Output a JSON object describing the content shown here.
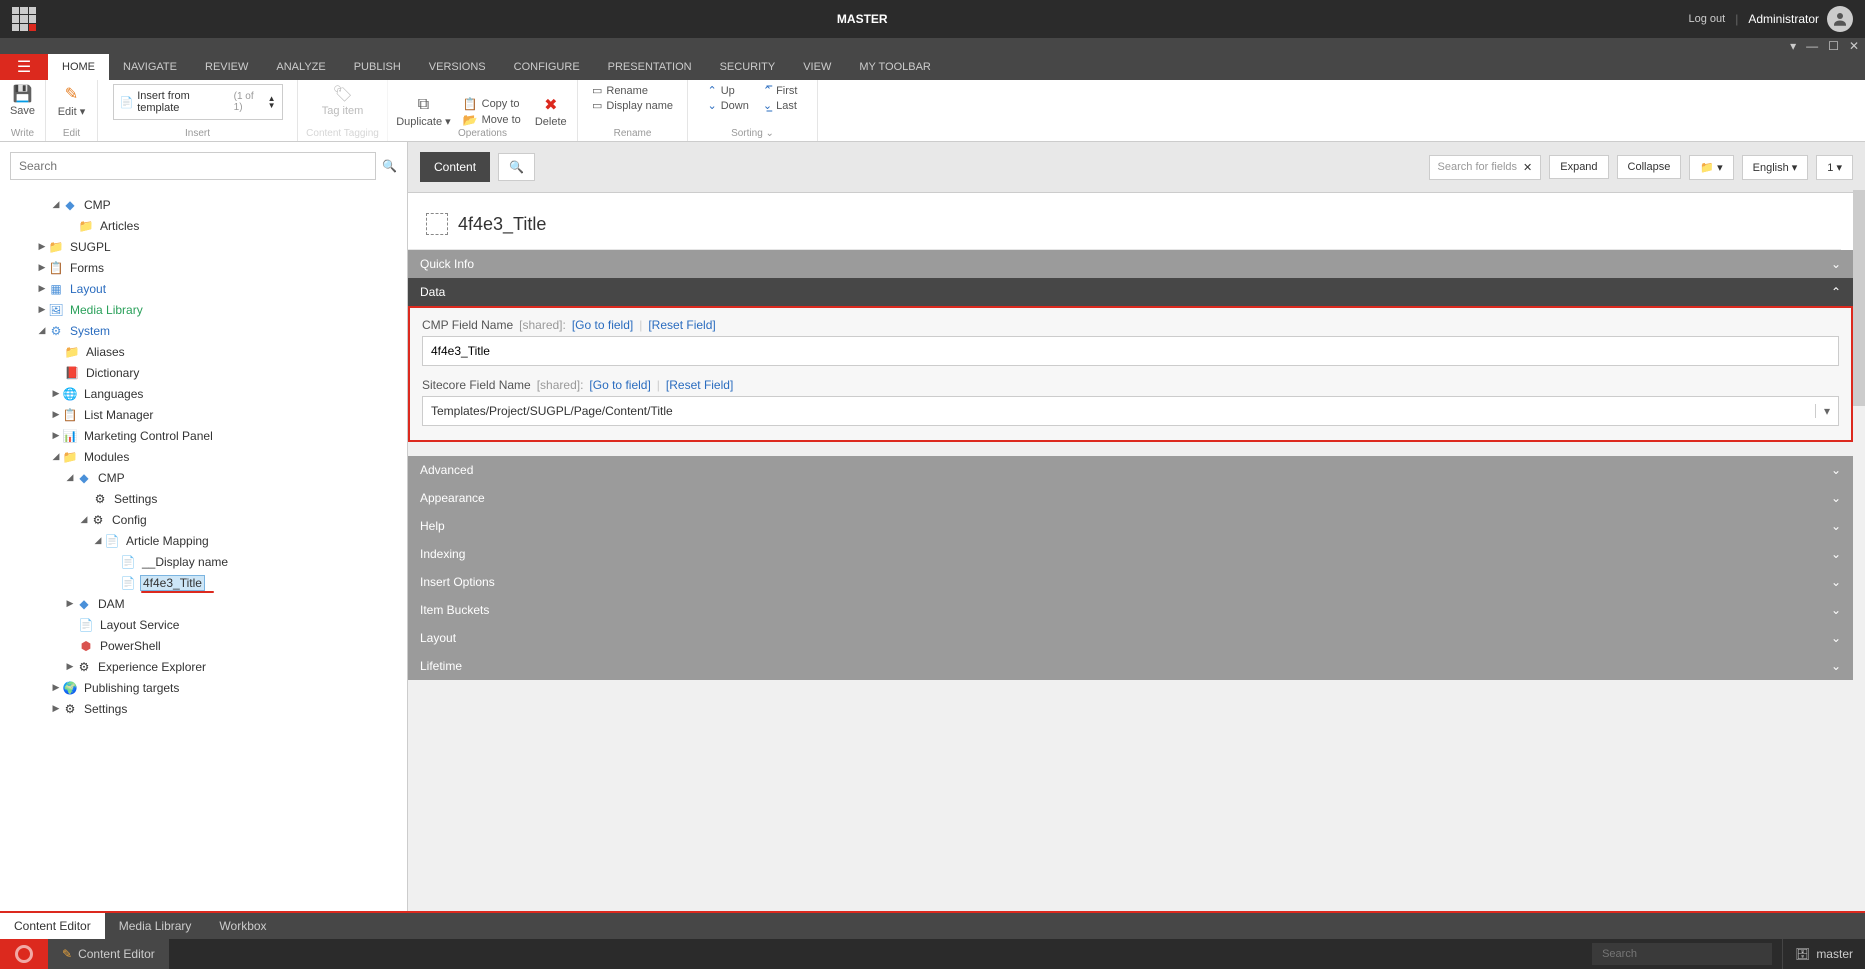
{
  "topbar": {
    "title": "MASTER",
    "logout": "Log out",
    "user": "Administrator"
  },
  "ribbonTabs": [
    "HOME",
    "NAVIGATE",
    "REVIEW",
    "ANALYZE",
    "PUBLISH",
    "VERSIONS",
    "CONFIGURE",
    "PRESENTATION",
    "SECURITY",
    "VIEW",
    "MY TOOLBAR"
  ],
  "ribbon": {
    "save": "Save",
    "write": "Write",
    "edit": "Edit ▾",
    "editSub": "Edit",
    "insertTemplate": "Insert from template",
    "insertCount": "(1 of 1)",
    "insertGroup": "Insert",
    "tagItem": "Tag item",
    "tagGroup": "Content Tagging",
    "duplicate": "Duplicate ▾",
    "copyTo": "Copy to",
    "moveTo": "Move to",
    "delete": "Delete",
    "opsGroup": "Operations",
    "rename": "Rename",
    "displayName": "Display name",
    "renameGroup": "Rename",
    "up": "Up",
    "down": "Down",
    "first": "First",
    "last": "Last",
    "sortGroup": "Sorting ⌄"
  },
  "sidebar": {
    "searchPlaceholder": "Search",
    "items": {
      "cmp": "CMP",
      "articles": "Articles",
      "sugpl": "SUGPL",
      "forms": "Forms",
      "layout": "Layout",
      "mediaLibrary": "Media Library",
      "system": "System",
      "aliases": "Aliases",
      "dictionary": "Dictionary",
      "languages": "Languages",
      "listManager": "List Manager",
      "marketing": "Marketing Control Panel",
      "modules": "Modules",
      "cmp2": "CMP",
      "settings": "Settings",
      "config": "Config",
      "articleMapping": "Article Mapping",
      "displayName": "__Display name",
      "title": "4f4e3_Title",
      "dam": "DAM",
      "layoutService": "Layout Service",
      "powershell": "PowerShell",
      "expExplorer": "Experience Explorer",
      "pubTargets": "Publishing targets",
      "settings2": "Settings"
    }
  },
  "content": {
    "contentBtn": "Content",
    "searchFieldsPlaceholder": "Search for fields",
    "expand": "Expand",
    "collapse": "Collapse",
    "lang": "English ▾",
    "ver": "1 ▾",
    "itemTitle": "4f4e3_Title",
    "sections": {
      "quickInfo": "Quick Info",
      "data": "Data",
      "advanced": "Advanced",
      "appearance": "Appearance",
      "help": "Help",
      "indexing": "Indexing",
      "insertOptions": "Insert Options",
      "itemBuckets": "Item Buckets",
      "layout": "Layout",
      "lifetime": "Lifetime"
    },
    "fields": {
      "cmpFieldName": "CMP Field Name",
      "sitecoreFieldName": "Sitecore Field Name",
      "shared": "[shared]:",
      "goToField": "[Go to field]",
      "resetField": "[Reset Field]",
      "cmpValue": "4f4e3_Title",
      "sitecoreValue": "Templates/Project/SUGPL/Page/Content/Title"
    }
  },
  "bottomTabs": [
    "Content Editor",
    "Media Library",
    "Workbox"
  ],
  "footer": {
    "app": "Content Editor",
    "searchPlaceholder": "Search",
    "db": "master"
  }
}
